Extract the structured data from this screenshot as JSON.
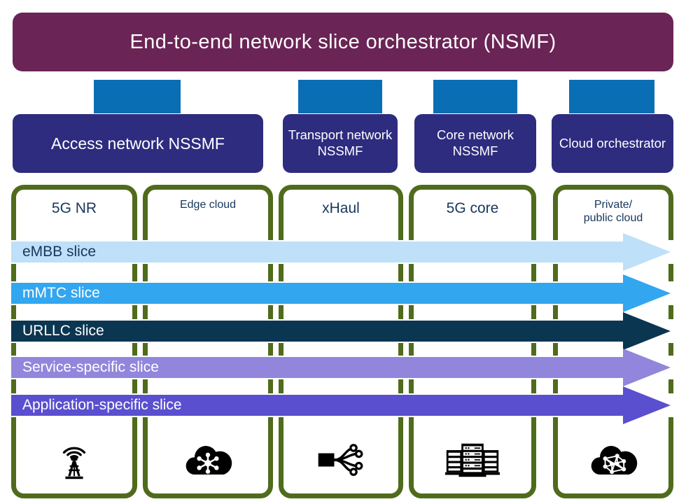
{
  "diagram": {
    "title": "End-to-end network slice orchestrator (NSMF)",
    "orchestrator": {
      "label": "End-to-end network slice orchestrator (NSMF)",
      "color": "#6A2455",
      "text_color": "#FFFFFF"
    },
    "connector_color": "#0A6EB4",
    "nssmf_color": "#2E2C7F",
    "column_border_color": "#4F6B1C",
    "column_label_color": "#17365D",
    "managers": [
      {
        "label": "Access network NSSMF",
        "spans": 2
      },
      {
        "label": "Transport network NSSMF",
        "spans": 1
      },
      {
        "label": "Core network NSSMF",
        "spans": 1
      },
      {
        "label": "Cloud orchestrator",
        "spans": 1
      }
    ],
    "domains": [
      {
        "label": "5G NR",
        "icon": "cell-tower-icon",
        "label_size": "lg"
      },
      {
        "label": "Edge cloud",
        "icon": "cloud-network-icon",
        "label_size": "sm"
      },
      {
        "label": "xHaul",
        "icon": "fiber-splitter-icon",
        "label_size": "lg"
      },
      {
        "label": "5G core",
        "icon": "server-rack-icon",
        "label_size": "lg"
      },
      {
        "label": "Private/\npublic cloud",
        "icon": "cloud-mesh-icon",
        "label_size": "sm"
      }
    ],
    "slices": [
      {
        "label": "eMBB slice",
        "color": "#BEE0F8",
        "text_color": "#17365D"
      },
      {
        "label": "mMTC slice",
        "color": "#33A6F0",
        "text_color": "#FFFFFF"
      },
      {
        "label": "URLLC slice",
        "color": "#0B3652",
        "text_color": "#FFFFFF"
      },
      {
        "label": "Service-specific slice",
        "color": "#9186DC",
        "text_color": "#FFFFFF"
      },
      {
        "label": "Application-specific slice",
        "color": "#5A4FCF",
        "text_color": "#FFFFFF"
      }
    ]
  }
}
